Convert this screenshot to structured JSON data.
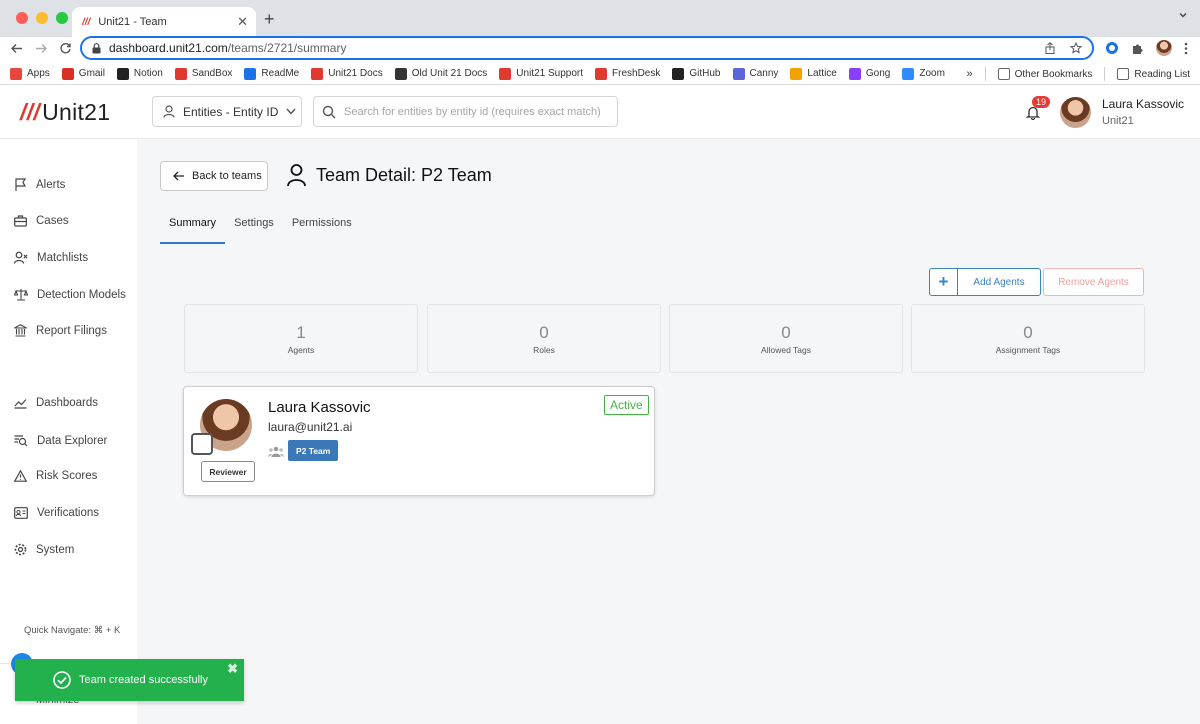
{
  "browser": {
    "tab_title": "Unit21 - Team",
    "url_host": "dashboard.unit21.com",
    "url_path": "/teams/2721/summary",
    "bookmarks": [
      {
        "label": "Apps",
        "color": "#e8453c"
      },
      {
        "label": "Gmail",
        "color": "#d93025"
      },
      {
        "label": "Notion",
        "color": "#222222"
      },
      {
        "label": "SandBox",
        "color": "#e0392f"
      },
      {
        "label": "ReadMe",
        "color": "#1a73e8"
      },
      {
        "label": "Unit21 Docs",
        "color": "#e0392f"
      },
      {
        "label": "Old Unit 21 Docs",
        "color": "#333333"
      },
      {
        "label": "Unit21 Support",
        "color": "#e0392f"
      },
      {
        "label": "FreshDesk",
        "color": "#e0392f"
      },
      {
        "label": "GitHub",
        "color": "#222222"
      },
      {
        "label": "Canny",
        "color": "#5a67d8"
      },
      {
        "label": "Lattice",
        "color": "#f4a100"
      },
      {
        "label": "Gong",
        "color": "#8a3ffc"
      },
      {
        "label": "Zoom",
        "color": "#2d8cff"
      }
    ],
    "overflow": "»",
    "other_bookmarks": "Other Bookmarks",
    "reading_list": "Reading List"
  },
  "header": {
    "logo": "Unit21",
    "logo_mark": "///",
    "entity_dropdown": "Entities - Entity ID",
    "search_placeholder": "Search for entities by entity id (requires exact match)",
    "notification_count": "19",
    "user_name": "Laura Kassovic",
    "user_org": "Unit21"
  },
  "sidebar": {
    "items": [
      {
        "label": "Alerts"
      },
      {
        "label": "Cases"
      },
      {
        "label": "Matchlists"
      },
      {
        "label": "Detection Models"
      },
      {
        "label": "Report Filings"
      },
      {
        "label": "Dashboards"
      },
      {
        "label": "Data Explorer"
      },
      {
        "label": "Risk Scores"
      },
      {
        "label": "Verifications"
      },
      {
        "label": "System"
      }
    ],
    "quick_navigate": "Quick Navigate: ⌘ + K",
    "minimize": "Minimize"
  },
  "page": {
    "back_label": "Back to teams",
    "title": "Team Detail: P2 Team",
    "tabs": [
      {
        "label": "Summary",
        "active": true
      },
      {
        "label": "Settings",
        "active": false
      },
      {
        "label": "Permissions",
        "active": false
      }
    ],
    "add_agents": "Add Agents",
    "remove_agents": "Remove Agents",
    "stats": [
      {
        "value": "1",
        "label": "Agents"
      },
      {
        "value": "0",
        "label": "Roles"
      },
      {
        "value": "0",
        "label": "Allowed Tags"
      },
      {
        "value": "0",
        "label": "Assignment Tags"
      }
    ],
    "agent": {
      "name": "Laura Kassovic",
      "email": "laura@unit21.ai",
      "role": "Reviewer",
      "team": "P2 Team",
      "status": "Active"
    }
  },
  "toast": {
    "message": "Team created successfully",
    "color": "#23b14d"
  }
}
